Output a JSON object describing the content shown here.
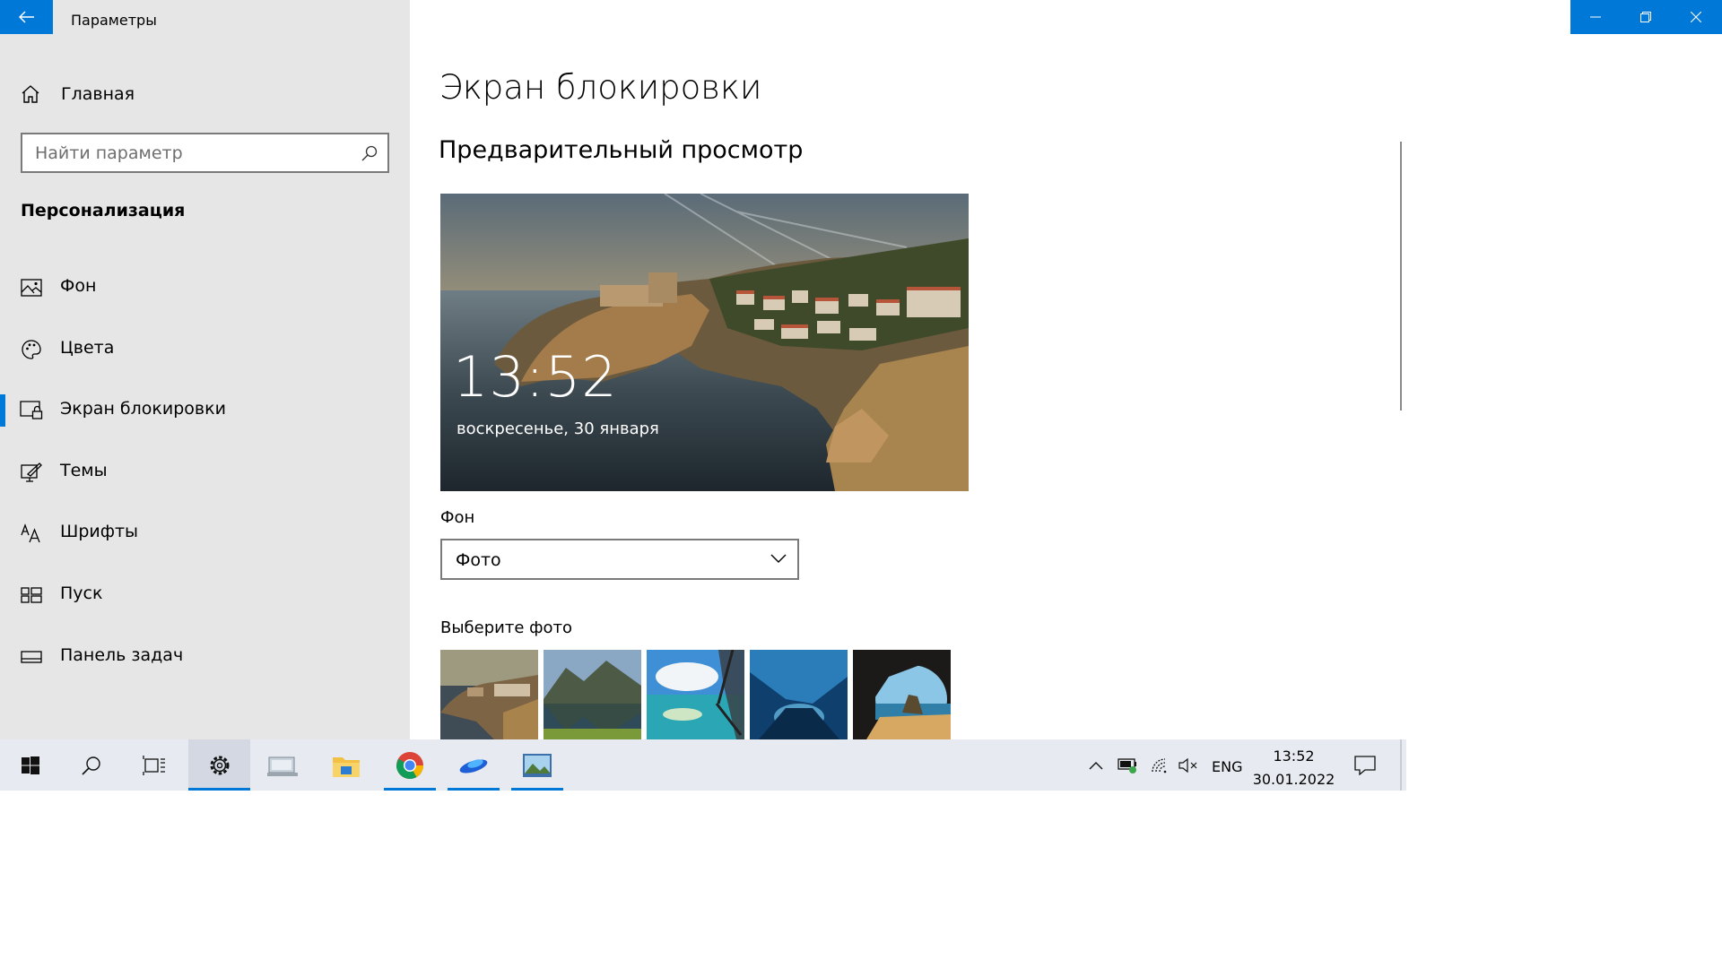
{
  "window": {
    "title": "Параметры",
    "back_icon": "arrow-left-icon",
    "controls": [
      "minimize-icon",
      "restore-icon",
      "close-icon"
    ],
    "accent": "#0078d7"
  },
  "sidebar": {
    "home_label": "Главная",
    "search_placeholder": "Найти параметр",
    "section": "Персонализация",
    "items": [
      {
        "label": "Фон",
        "icon": "picture-icon",
        "active": false
      },
      {
        "label": "Цвета",
        "icon": "palette-icon",
        "active": false
      },
      {
        "label": "Экран блокировки",
        "icon": "lock-screen-icon",
        "active": true
      },
      {
        "label": "Темы",
        "icon": "brush-icon",
        "active": false
      },
      {
        "label": "Шрифты",
        "icon": "font-icon",
        "active": false
      },
      {
        "label": "Пуск",
        "icon": "start-layout-icon",
        "active": false
      },
      {
        "label": "Панель задач",
        "icon": "taskbar-icon",
        "active": false
      }
    ]
  },
  "main": {
    "title": "Экран блокировки",
    "preview_heading": "Предварительный просмотр",
    "preview": {
      "time": "13:52",
      "date": "воскресенье, 30 января"
    },
    "background_label": "Фон",
    "background_value": "Фото",
    "choose_photo_label": "Выберите фото",
    "thumbnails": [
      "coastal-town-photo",
      "mountain-lake-photo",
      "tropical-island-photo",
      "ice-cave-photo",
      "beach-cave-photo"
    ]
  },
  "taskbar": {
    "apps": [
      "windows-start-icon",
      "search-icon",
      "task-view-icon",
      "settings-icon",
      "network-computer-icon",
      "file-explorer-icon",
      "chrome-icon",
      "app-blue-icon",
      "photos-icon"
    ],
    "active_app": "settings-icon",
    "tray": {
      "lang": "ENG",
      "time": "13:52",
      "date": "30.01.2022"
    }
  }
}
